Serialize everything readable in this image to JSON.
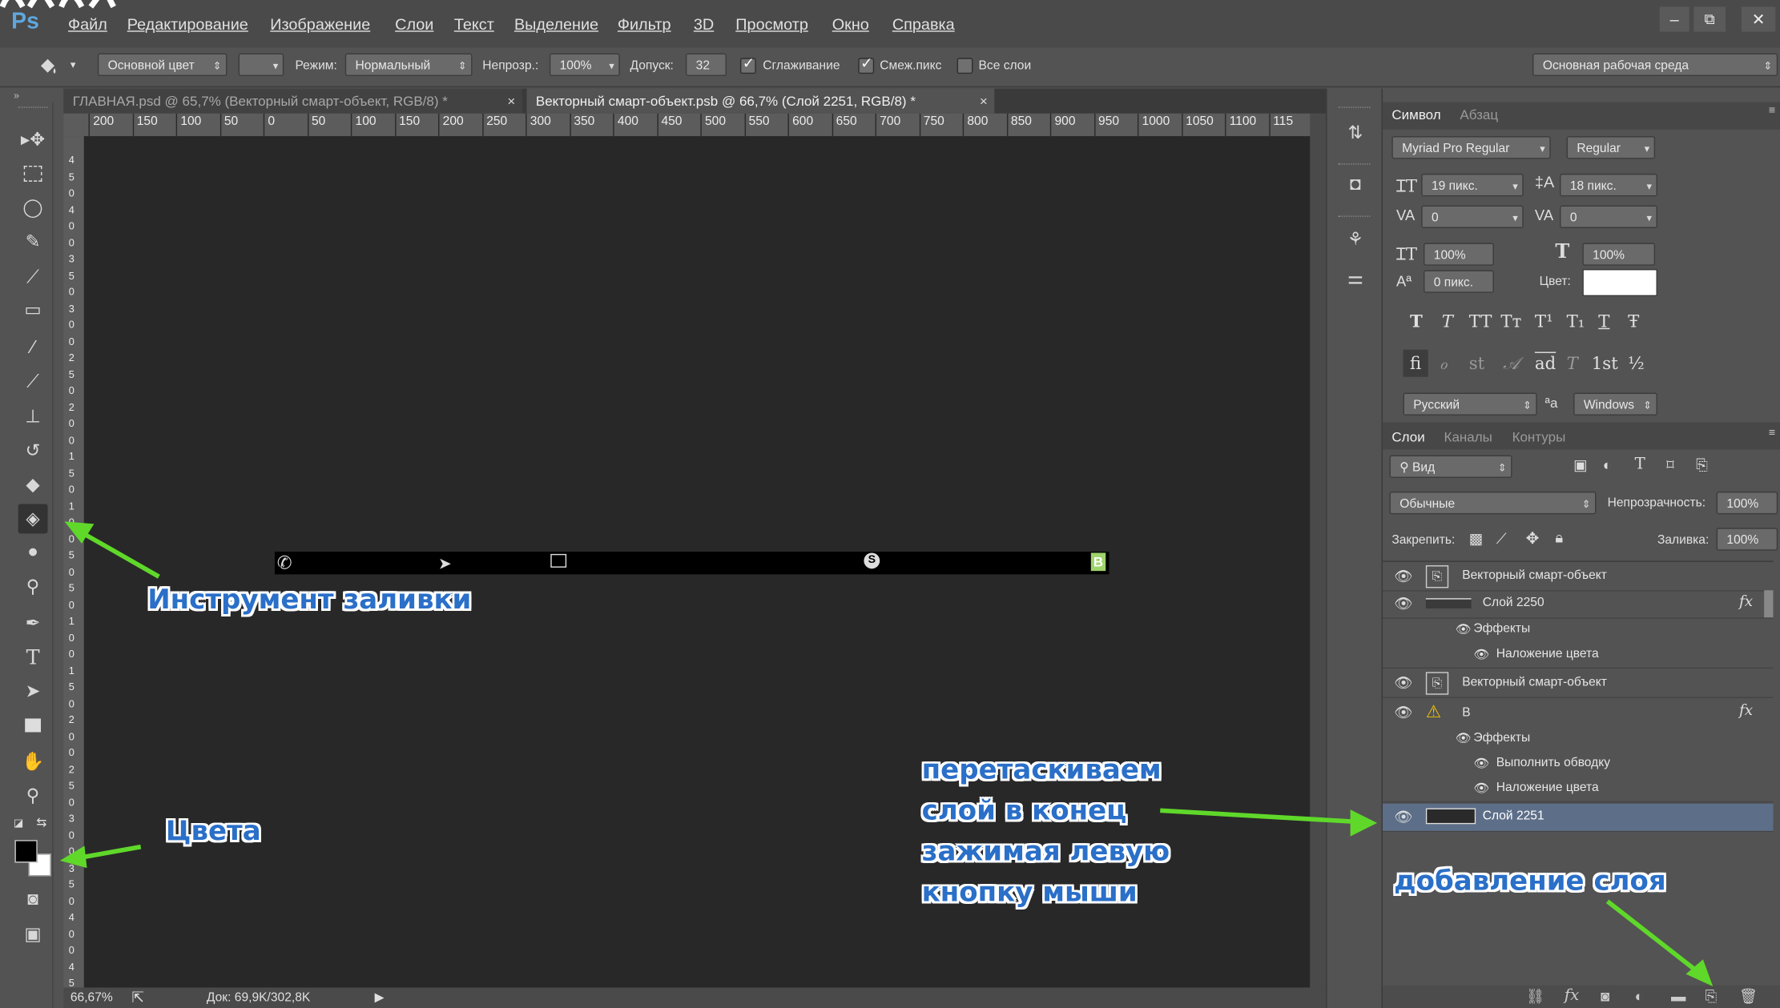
{
  "app": {
    "logo": "Ps",
    "title_fragment": "…"
  },
  "menu": [
    "Файл",
    "Редактирование",
    "Изображение",
    "Слои",
    "Текст",
    "Выделение",
    "Фильтр",
    "3D",
    "Просмотр",
    "Окно",
    "Справка"
  ],
  "window_controls": {
    "minimize": "–",
    "restore": "⧉",
    "close": "✕"
  },
  "options": {
    "fill_source": "Основной цвет",
    "mode_label": "Режим:",
    "mode_value": "Нормальный",
    "opacity_label": "Непрозр.:",
    "opacity_value": "100%",
    "tolerance_label": "Допуск:",
    "tolerance_value": "32",
    "antialias_label": "Сглаживание",
    "contiguous_label": "Смеж.пикс",
    "all_layers_label": "Все слои",
    "workspace": "Основная рабочая среда"
  },
  "tabs": [
    {
      "label": "ГЛАВНАЯ.psd @ 65,7% (Векторный смарт-объект, RGB/8) *",
      "close": "×"
    },
    {
      "label": "Векторный смарт-объект.psb @ 66,7% (Слой 2251, RGB/8) *",
      "close": "×"
    }
  ],
  "ruler_h": [
    "200",
    "150",
    "100",
    "50",
    "0",
    "50",
    "100",
    "150",
    "200",
    "250",
    "300",
    "350",
    "400",
    "450",
    "500",
    "550",
    "600",
    "650",
    "700",
    "750",
    "800",
    "850",
    "900",
    "950",
    "1000",
    "1050",
    "1100",
    "115"
  ],
  "ruler_v": [
    "4",
    "5",
    "0",
    "4",
    "0",
    "0",
    "3",
    "5",
    "0",
    "3",
    "0",
    "0",
    "2",
    "5",
    "0",
    "2",
    "0",
    "0",
    "1",
    "5",
    "0",
    "1",
    "0",
    "0",
    "5",
    "0",
    "5",
    "0",
    "1",
    "0",
    "0",
    "1",
    "5",
    "0",
    "2",
    "0",
    "0",
    "2",
    "5",
    "0",
    "3",
    "0",
    "0",
    "3",
    "5",
    "0",
    "4",
    "0",
    "0",
    "4",
    "5"
  ],
  "status": {
    "zoom": "66,67%",
    "doc": "Док: 69,9K/302,8K"
  },
  "character_panel": {
    "tab_active": "Символ",
    "tab_inactive": "Абзац",
    "font_family": "Myriad Pro Regular",
    "font_style": "Regular",
    "size": "19 пикс.",
    "leading": "18 пикс.",
    "kerning": "0",
    "tracking": "0",
    "vscale": "100%",
    "hscale": "100%",
    "baseline": "0 пикс.",
    "color_label": "Цвет:",
    "style_buttons": [
      "T",
      "T",
      "TT",
      "Tт",
      "T¹",
      "T₁",
      "T",
      "Ŧ"
    ],
    "ot_buttons": [
      "fi",
      "ℴ",
      "st",
      "𝒜",
      "ad",
      "T",
      "1st",
      "½"
    ],
    "language": "Русский",
    "aa_icon": "ªa",
    "aa_method": "Windows"
  },
  "layers_panel": {
    "tabs": [
      "Слои",
      "Каналы",
      "Контуры"
    ],
    "filter": "Вид",
    "blend": "Обычные",
    "opacity_label": "Непрозрачность:",
    "opacity": "100%",
    "lock_label": "Закрепить:",
    "fill_label": "Заливка:",
    "fill": "100%",
    "layers": [
      {
        "name": "Векторный смарт-объект",
        "kind": "smart"
      },
      {
        "name": "Слой 2250",
        "kind": "line",
        "fx": "fx"
      },
      {
        "name": "Эффекты",
        "kind": "effects"
      },
      {
        "name": "Наложение цвета",
        "kind": "effect"
      },
      {
        "name": "Векторный смарт-объект",
        "kind": "smart"
      },
      {
        "name": "B",
        "kind": "warning",
        "fx": "fx"
      },
      {
        "name": "Эффекты",
        "kind": "effects"
      },
      {
        "name": "Выполнить обводку",
        "kind": "effect"
      },
      {
        "name": "Наложение цвета",
        "kind": "effect"
      },
      {
        "name": "Слой 2251",
        "kind": "line-selected"
      }
    ]
  },
  "canvas_bar": {
    "b_letter": "B",
    "s_letter": "S"
  },
  "annotations": {
    "fill_tool": "Инструмент заливки",
    "colors": "Цвета",
    "drag_line1": "перетаскиваем",
    "drag_line2": "слой в конец",
    "drag_line3": "зажимая левую",
    "drag_line4": "кнопку мыши",
    "add_layer": "добавление слоя"
  },
  "colors": {
    "accent_annotation": "#2a6fc8",
    "arrow": "#5fd82a",
    "selected_layer": "#5d6e88"
  }
}
